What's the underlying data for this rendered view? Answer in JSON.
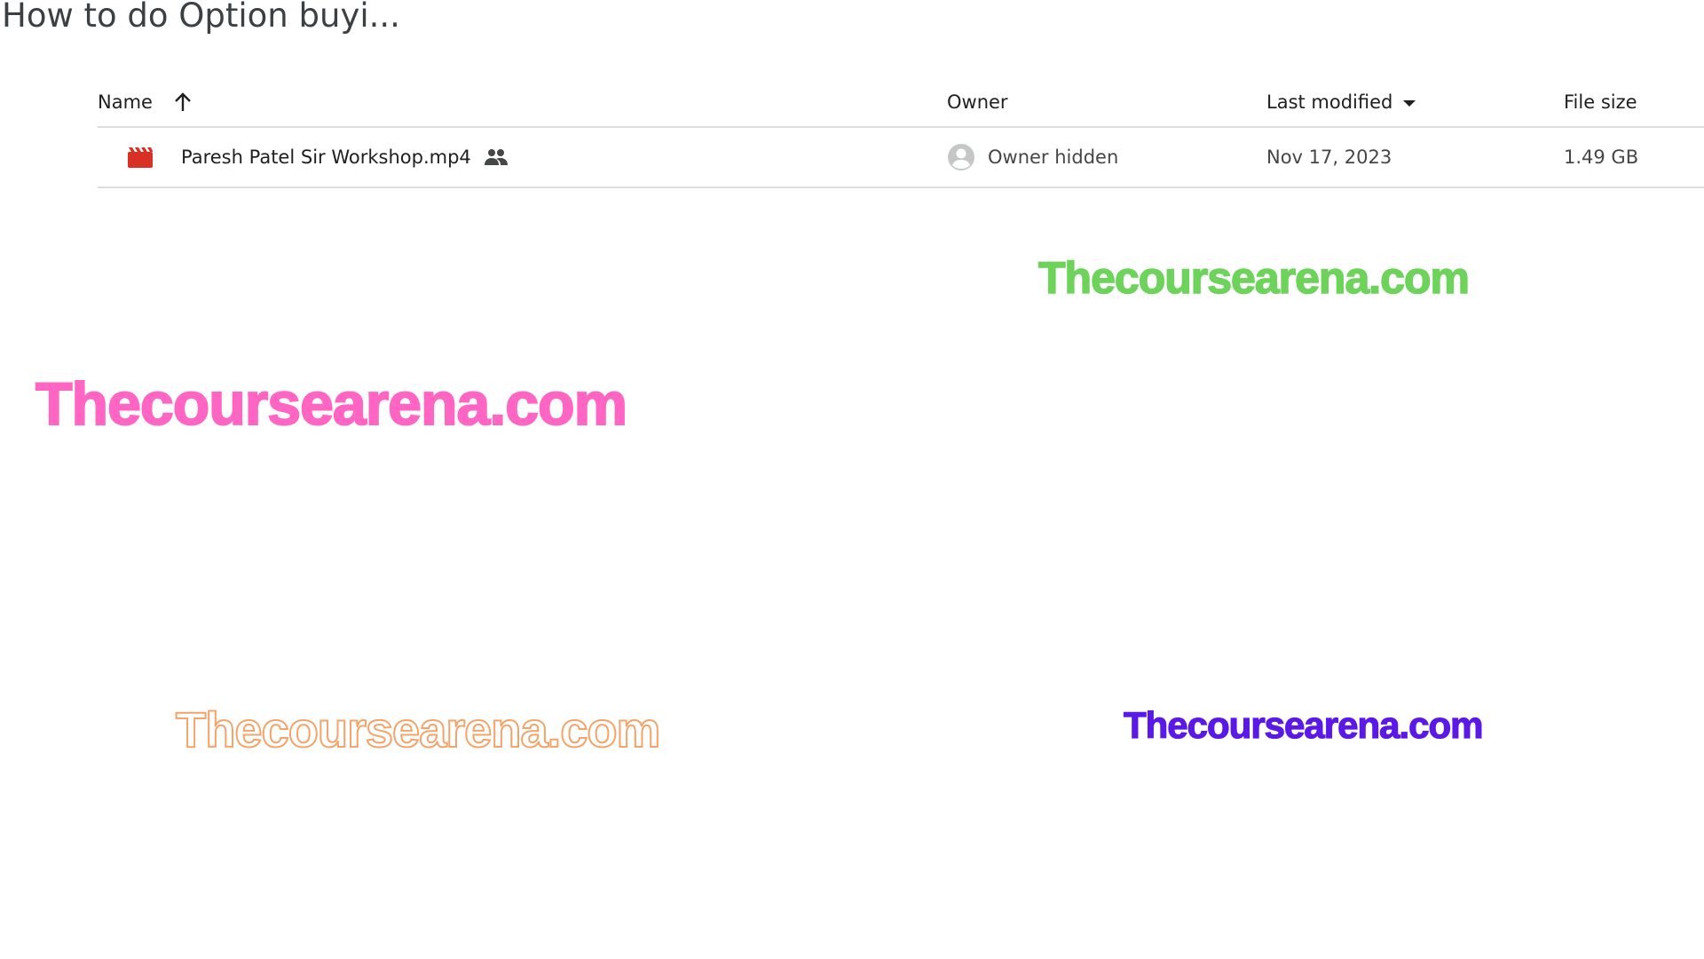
{
  "folder": {
    "title": "How to do Option buyi..."
  },
  "table": {
    "columns": {
      "name": "Name",
      "owner": "Owner",
      "last_modified": "Last modified",
      "file_size": "File size"
    },
    "sort": {
      "name_direction_icon": "arrow-up-icon",
      "last_modified_icon": "caret-down-icon"
    },
    "rows": [
      {
        "type_icon": "video-file-icon",
        "name": "Paresh Patel Sir Workshop.mp4",
        "shared_icon": "people-icon",
        "owner": "Owner hidden",
        "owner_avatar_icon": "account-circle-icon",
        "last_modified": "Nov 17, 2023",
        "file_size": "1.49 GB"
      }
    ]
  },
  "watermarks": [
    {
      "text": "Thecoursearena.com",
      "color": "#6dd35a",
      "style": "solid"
    },
    {
      "text": "Thecoursearena.com",
      "color": "#ff66c4",
      "style": "solid"
    },
    {
      "text": "Thecoursearena.com",
      "color": "#f4a46a",
      "style": "outline"
    },
    {
      "text": "Thecoursearena.com",
      "color": "#5b19e8",
      "style": "solid"
    }
  ],
  "colors": {
    "video_icon": "#d93025",
    "text_primary": "#1f1f1f",
    "text_secondary": "#444746",
    "divider": "#dadce0",
    "avatar": "#c4c7c5"
  }
}
